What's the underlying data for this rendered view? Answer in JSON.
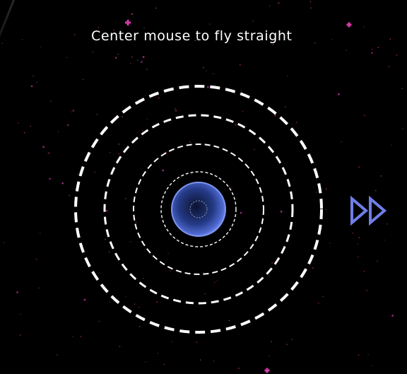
{
  "hud": {
    "hint_text": "Center mouse to fly straight"
  },
  "controls": {
    "fast_forward_icon": "fast-forward-icon"
  },
  "colors": {
    "background": "#000000",
    "star": "#c0349c",
    "ring": "#ffffff",
    "planet": "#6f86e6",
    "fast_forward": "#6f7fe6"
  }
}
